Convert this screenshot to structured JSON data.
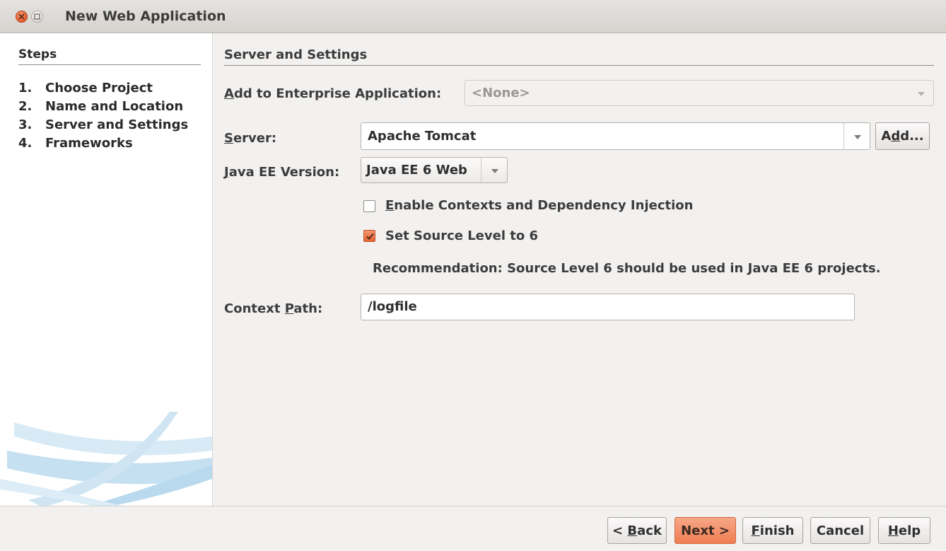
{
  "window": {
    "title": "New Web Application"
  },
  "steps": {
    "header": "Steps",
    "items": [
      {
        "num": "1.",
        "label": "Choose Project"
      },
      {
        "num": "2.",
        "label": "Name and Location"
      },
      {
        "num": "3.",
        "label": "Server and Settings"
      },
      {
        "num": "4.",
        "label": "Frameworks"
      }
    ]
  },
  "main": {
    "section_title": "Server and Settings",
    "enterprise": {
      "label_pre": "",
      "label_u": "A",
      "label_post": "dd to Enterprise Application:",
      "value": "<None>"
    },
    "server": {
      "label_u": "S",
      "label_post": "erver:",
      "value": "Apache Tomcat",
      "add_pre": "A",
      "add_u": "d",
      "add_post": "d..."
    },
    "javaee": {
      "label_u": "J",
      "label_post": "ava EE Version:",
      "value": "Java EE 6 Web"
    },
    "cdi": {
      "label_u": "E",
      "label_post": "nable Contexts and Dependency Injection",
      "checked": false
    },
    "source_level": {
      "label": "Set Source Level to 6",
      "checked": true
    },
    "recommendation": "Recommendation: Source Level 6 should be used in Java EE 6 projects.",
    "context_path": {
      "label_pre": "Context ",
      "label_u": "P",
      "label_post": "ath:",
      "value": "/logfile"
    }
  },
  "buttons": {
    "back": {
      "pre": "< ",
      "u": "B",
      "post": "ack"
    },
    "next": {
      "label": "Next >"
    },
    "finish": {
      "u": "F",
      "post": "inish"
    },
    "cancel": {
      "label": "Cancel"
    },
    "help": {
      "u": "H",
      "post": "elp"
    }
  },
  "colors": {
    "accent": "#ef7e54",
    "window_bg": "#f2f1f0"
  }
}
